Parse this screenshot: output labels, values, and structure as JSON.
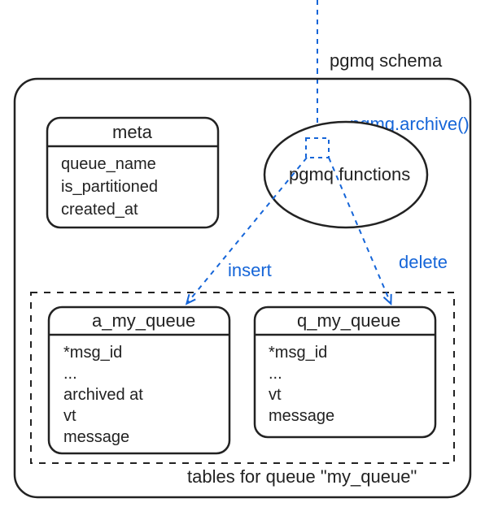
{
  "labels": {
    "schema": "pgmq schema",
    "archive_call": "pgmq.archive()",
    "functions": "pgmq functions",
    "insert": "insert",
    "delete": "delete",
    "tables_caption": "tables for queue \"my_queue\""
  },
  "meta_table": {
    "title": "meta",
    "fields": [
      "queue_name",
      "is_partitioned",
      "created_at"
    ]
  },
  "a_table": {
    "title": "a_my_queue",
    "fields": [
      "*msg_id",
      "...",
      "archived at",
      "vt",
      "message"
    ]
  },
  "q_table": {
    "title": "q_my_queue",
    "fields": [
      "*msg_id",
      "...",
      "vt",
      "message"
    ]
  }
}
